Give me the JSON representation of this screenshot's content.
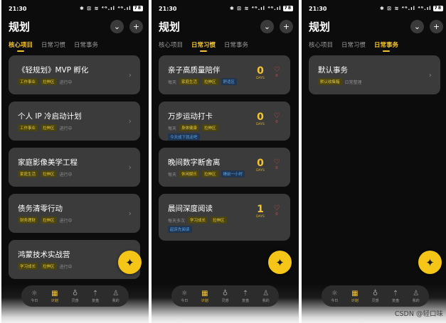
{
  "status": {
    "time": "21:30",
    "icons": "✱ ⊡ ≋ ⁴ᴳ.ıl ⁴ᴳ.ıl",
    "battery": "78"
  },
  "header": {
    "title": "规划",
    "dropdown_icon": "chevron-down-icon",
    "add_icon": "plus-icon"
  },
  "tabs": [
    "核心项目",
    "日常习惯",
    "日常事务"
  ],
  "screen1": {
    "active_tab": 0,
    "projects": [
      {
        "title": "《轻规划》MVP 孵化",
        "tags": [
          "工作事业",
          "拉伸区"
        ],
        "status": "进行中"
      },
      {
        "title": "个人 IP 冷启动计划",
        "tags": [
          "工作事业",
          "拉伸区"
        ],
        "status": "进行中"
      },
      {
        "title": "家庭影像美学工程",
        "tags": [
          "家庭生活",
          "拉伸区"
        ],
        "status": "进行中"
      },
      {
        "title": "债务清零行动",
        "tags": [
          "财务理财",
          "拉伸区"
        ],
        "status": "进行中"
      },
      {
        "title": "鸿蒙技术实战营",
        "tags": [
          "学习成长",
          "拉伸区"
        ],
        "status": "进行中"
      }
    ]
  },
  "screen2": {
    "active_tab": 1,
    "habits": [
      {
        "title": "亲子高质量陪伴",
        "freq": "每天",
        "tags": [
          "家庭生活",
          "拉伸区"
        ],
        "blue_tags": [
          "舒适区"
        ],
        "days": "0",
        "days_label": "DAYS",
        "likes": "0"
      },
      {
        "title": "万步运动打卡",
        "freq": "每天",
        "tags": [
          "身体健康",
          "拉伸区"
        ],
        "blue_tags": [
          "今天成下就走吧"
        ],
        "days": "0",
        "days_label": "DAYS",
        "likes": "0"
      },
      {
        "title": "晚间数字断舍离",
        "freq": "每天",
        "tags": [
          "休闲娱乐",
          "拉伸区"
        ],
        "blue_tags": [
          "睡前一小时"
        ],
        "days": "0",
        "days_label": "DAYS",
        "likes": "0"
      },
      {
        "title": "晨间深度阅读",
        "freq": "每天多次",
        "tags": [
          "学习成长",
          "拉伸区"
        ],
        "blue_tags": [
          "起床先阅读"
        ],
        "days": "1",
        "days_label": "DAYS",
        "likes": "0"
      }
    ]
  },
  "screen3": {
    "active_tab": 2,
    "affairs": [
      {
        "title": "默认事务",
        "tags": [
          "默认收集箱"
        ],
        "note": "日常整理"
      }
    ]
  },
  "fab_icon": "sparkle-icon",
  "nav": [
    {
      "label": "今日",
      "icon": "sun-icon",
      "glyph": "☼"
    },
    {
      "label": "计划",
      "icon": "calendar-icon",
      "glyph": "▦"
    },
    {
      "label": "灵感",
      "icon": "bulb-icon",
      "glyph": "♁"
    },
    {
      "label": "复盘",
      "icon": "compass-icon",
      "glyph": "⇡"
    },
    {
      "label": "我的",
      "icon": "person-icon",
      "glyph": "♙"
    }
  ],
  "nav_active": 1,
  "watermark": "CSDN @轻口味",
  "colors": {
    "accent": "#f4c430",
    "card": "#3b3b3b",
    "bg": "#0c0c0c",
    "tag_yellow_bg": "#4a4412",
    "tag_blue_text": "#5aa7ef",
    "heart": "#e04b4b"
  }
}
